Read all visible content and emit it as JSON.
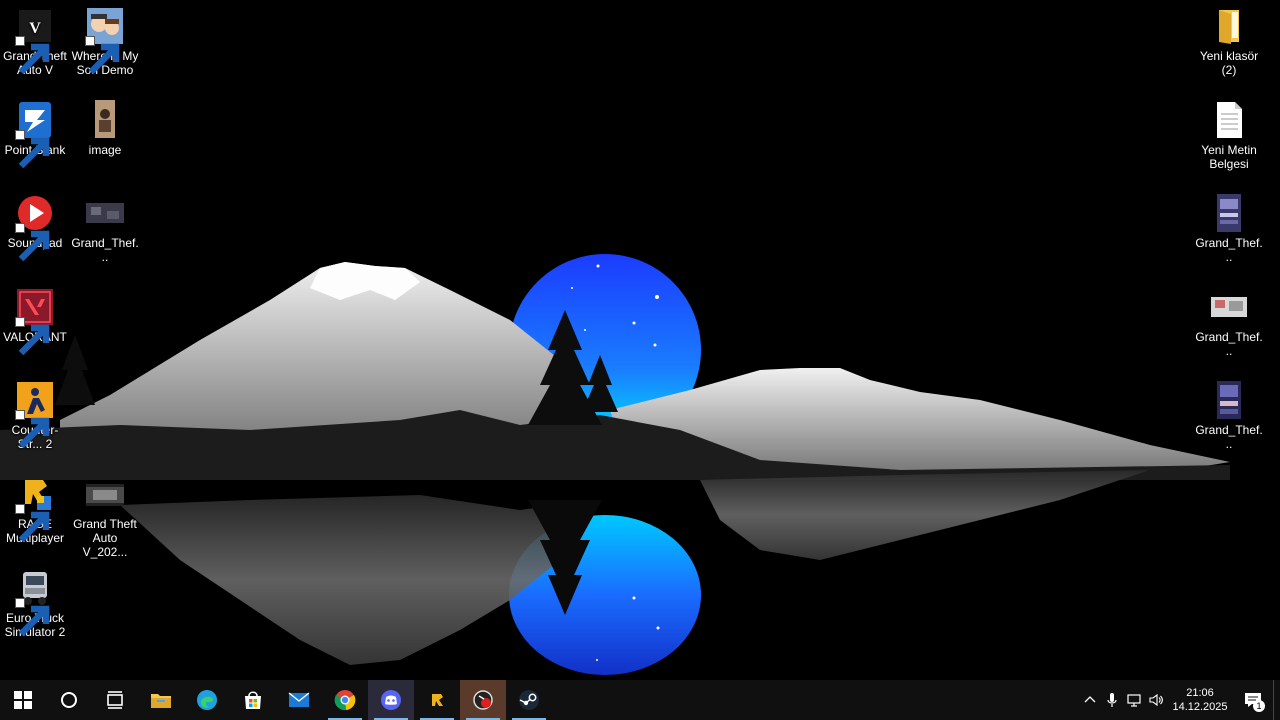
{
  "desktop": {
    "left_icons": [
      {
        "label": "Grand Theft Auto V",
        "icon": "gta5-icon",
        "shortcut": true
      },
      {
        "label": "Where is My Son Demo",
        "icon": "game-characters-icon",
        "shortcut": true
      },
      {
        "label": "Point Blank",
        "icon": "point-blank-icon",
        "shortcut": true
      },
      {
        "label": "image",
        "icon": "image-file-icon",
        "shortcut": false
      },
      {
        "label": "Soundpad",
        "icon": "soundpad-icon",
        "shortcut": true
      },
      {
        "label": "Grand_Thef...",
        "icon": "image-file-icon",
        "shortcut": false
      },
      {
        "label": "VALORANT",
        "icon": "valorant-icon",
        "shortcut": true
      },
      {
        "label": "Counter-Str... 2",
        "icon": "counter-strike-icon",
        "shortcut": true
      },
      {
        "label": "RAGE Multiplayer",
        "icon": "rage-mp-icon",
        "shortcut": true
      },
      {
        "label": "Grand Theft Auto V_202...",
        "icon": "video-file-icon",
        "shortcut": false
      },
      {
        "label": "Euro Truck Simulator 2",
        "icon": "truck-icon",
        "shortcut": true
      }
    ],
    "right_icons": [
      {
        "label": "Yeni klasör (2)",
        "icon": "folder-icon"
      },
      {
        "label": "Yeni Metin Belgesi",
        "icon": "text-document-icon"
      },
      {
        "label": "Grand_Thef...",
        "icon": "image-file-icon"
      },
      {
        "label": "Grand_Thef...",
        "icon": "image-file-icon"
      },
      {
        "label": "Grand_Thef...",
        "icon": "image-file-icon"
      }
    ]
  },
  "taskbar": {
    "start": "windows-start-icon",
    "search": "cortana-search-icon",
    "task_view": "task-view-icon",
    "apps": [
      {
        "name": "file-explorer",
        "icon": "folder-icon"
      },
      {
        "name": "edge",
        "icon": "edge-icon"
      },
      {
        "name": "store",
        "icon": "store-icon"
      },
      {
        "name": "mail",
        "icon": "mail-icon"
      },
      {
        "name": "chrome",
        "icon": "chrome-icon"
      },
      {
        "name": "discord",
        "icon": "discord-icon"
      },
      {
        "name": "rage-mp",
        "icon": "rage-mp-icon"
      },
      {
        "name": "recorder",
        "icon": "record-icon"
      },
      {
        "name": "steam",
        "icon": "steam-icon"
      }
    ],
    "tray": {
      "time": "21:06",
      "date": "14.12.2025",
      "notification_count": "1"
    }
  },
  "colors": {
    "taskbar_bg": "#101010",
    "accent": "#76b9ed",
    "moon_top": "#1b3cff",
    "moon_bottom": "#00e5ff"
  }
}
